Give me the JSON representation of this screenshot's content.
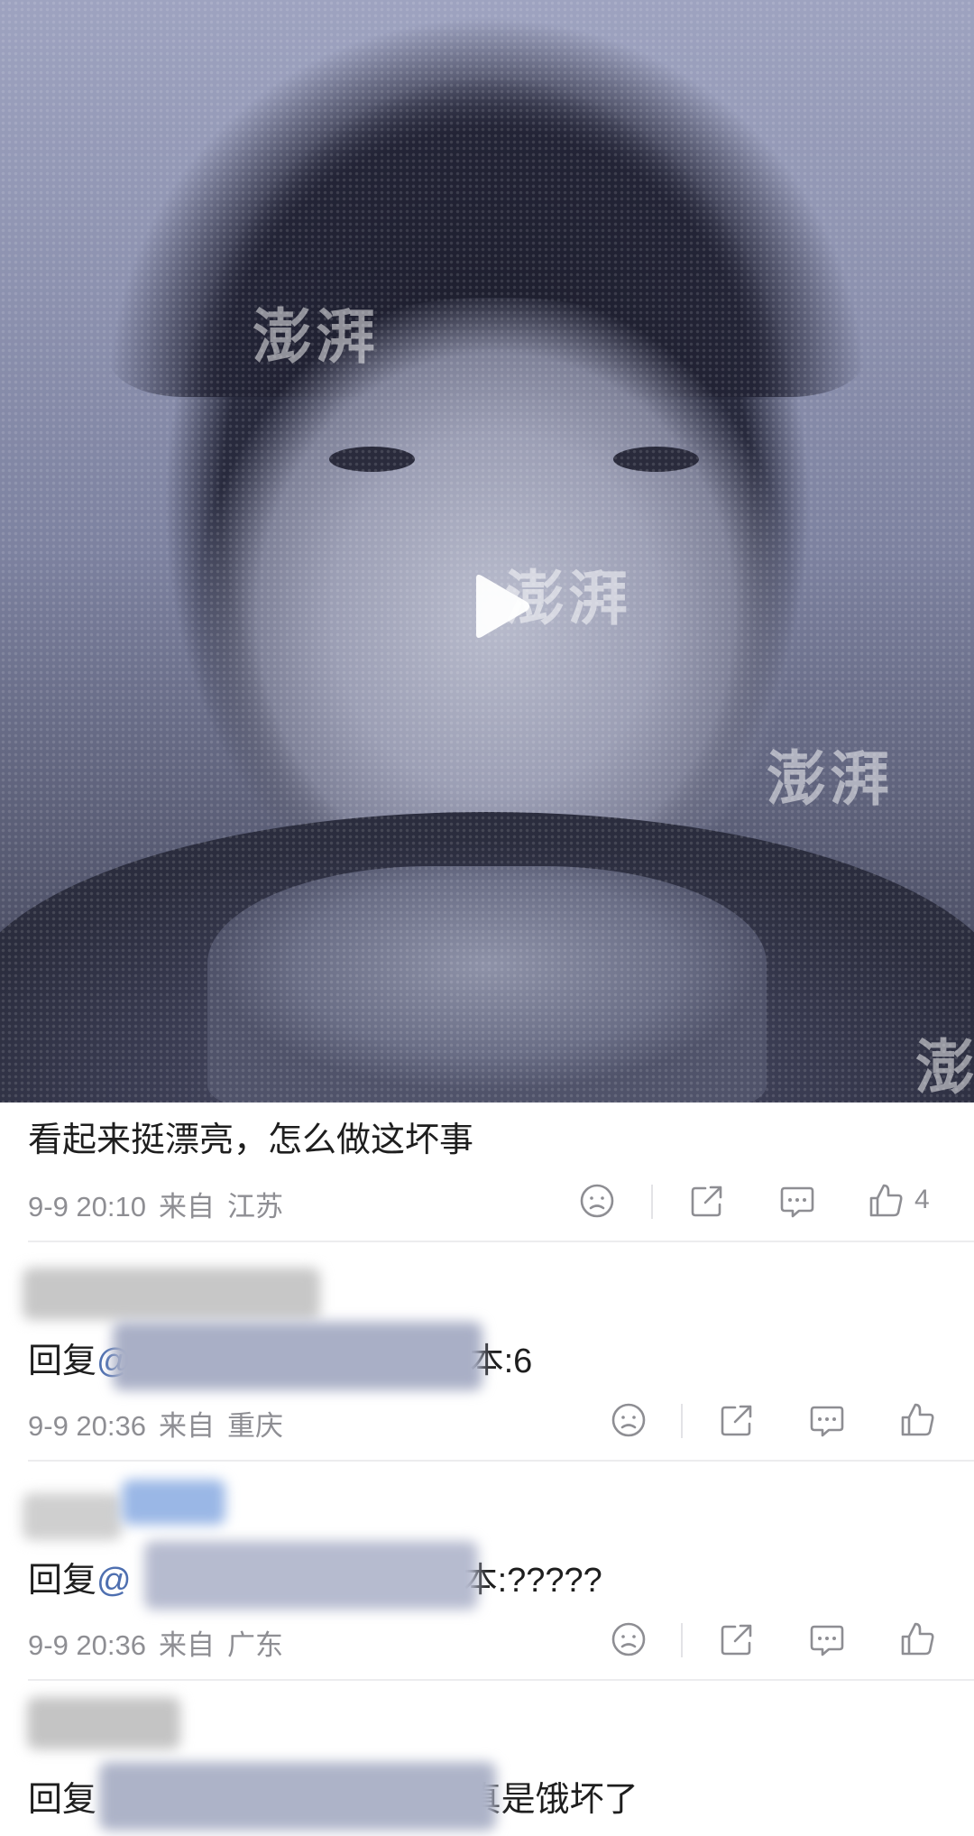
{
  "video": {
    "watermark_text": "澎湃",
    "play_icon": "play-icon"
  },
  "comments": [
    {
      "text": "看起来挺漂亮，怎么做这坏事",
      "date": "9-9 20:10",
      "from_label": "来自",
      "location": "江苏",
      "like_count": "4"
    },
    {
      "reply_label": "回复",
      "mention_prefix": "@",
      "text_tail": "本:6",
      "date": "9-9 20:36",
      "from_label": "来自",
      "location": "重庆"
    },
    {
      "reply_label": "回复",
      "mention_prefix": "@",
      "text_tail": "本:?????",
      "date": "9-9 20:36",
      "from_label": "来自",
      "location": "广东"
    },
    {
      "reply_label": "回复",
      "text_tail": ":真是饿坏了"
    }
  ],
  "icons": {
    "dislike": "dislike-face-icon",
    "share": "share-icon",
    "comment": "comment-icon",
    "like": "thumbs-up-icon"
  },
  "colors": {
    "meta_gray": "#8e8e93",
    "mention_blue": "#4e6fb0",
    "divider": "#ececee"
  }
}
